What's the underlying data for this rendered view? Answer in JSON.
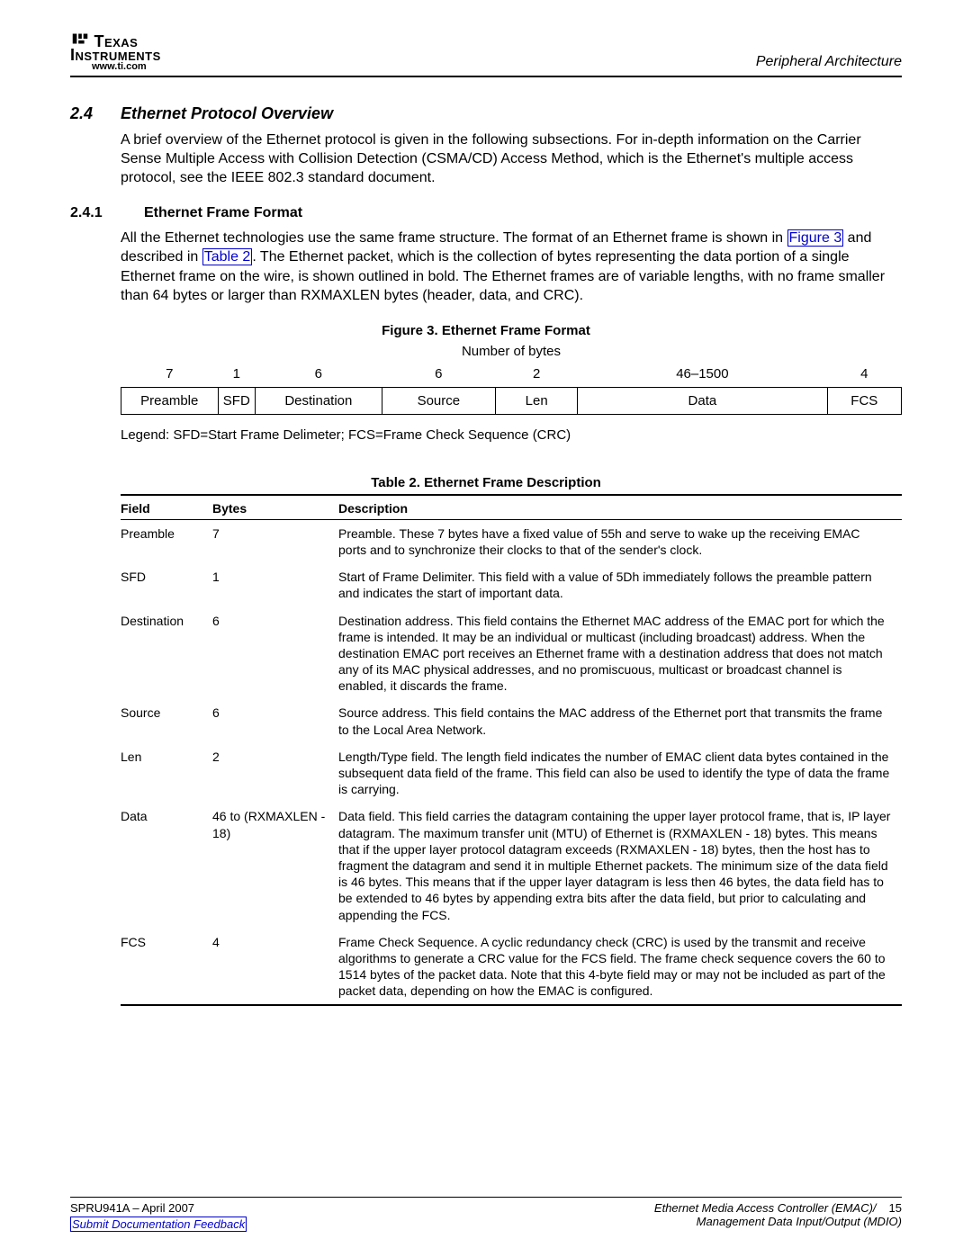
{
  "header": {
    "brand2": "Texas",
    "brand3": "Instruments",
    "url": "www.ti.com",
    "section_label": "Peripheral Architecture"
  },
  "section": {
    "num": "2.4",
    "title": "Ethernet Protocol Overview",
    "intro": "A brief overview of the Ethernet protocol is given in the following subsections. For in-depth information on the Carrier Sense Multiple Access with Collision Detection (CSMA/CD) Access Method, which is the Ethernet's multiple access protocol, see the IEEE 802.3 standard document."
  },
  "subsection": {
    "num": "2.4.1",
    "title": "Ethernet Frame Format",
    "p_pre": "All the Ethernet technologies use the same frame structure. The format of an Ethernet frame is shown in ",
    "link1": "Figure 3",
    "p_mid": " and described in ",
    "link2": "Table 2",
    "p_post": ". The Ethernet packet, which is the collection of bytes representing the data portion of a single Ethernet frame on the wire, is shown outlined in bold. The Ethernet frames are of variable lengths, with no frame smaller than 64 bytes or larger than RXMAXLEN bytes (header, data, and CRC)."
  },
  "figure": {
    "title": "Figure 3. Ethernet Frame Format",
    "num_bytes_label": "Number of bytes",
    "bytes": [
      "7",
      "1",
      "6",
      "6",
      "2",
      "46–1500",
      "4"
    ],
    "cells": [
      "Preamble",
      "SFD",
      "Destination",
      "Source",
      "Len",
      "Data",
      "FCS"
    ],
    "legend": "Legend: SFD=Start Frame Delimeter; FCS=Frame Check Sequence (CRC)"
  },
  "table": {
    "title": "Table 2. Ethernet Frame Description",
    "headers": [
      "Field",
      "Bytes",
      "Description"
    ],
    "rows": [
      {
        "field": "Preamble",
        "bytes": "7",
        "desc": "Preamble. These 7 bytes have a fixed value of 55h and serve to wake up the receiving EMAC ports and to synchronize their clocks to that of the sender's clock."
      },
      {
        "field": "SFD",
        "bytes": "1",
        "desc": "Start of Frame Delimiter. This field with a value of 5Dh immediately follows the preamble pattern and indicates the start of important data."
      },
      {
        "field": "Destination",
        "bytes": "6",
        "desc": "Destination address. This field contains the Ethernet MAC address of the EMAC port for which the frame is intended. It may be an individual or multicast (including broadcast) address. When the destination EMAC port receives an Ethernet frame with a destination address that does not match any of its MAC physical addresses, and no promiscuous, multicast or broadcast channel is enabled, it discards the frame."
      },
      {
        "field": "Source",
        "bytes": "6",
        "desc": "Source address. This field contains the MAC address of the Ethernet port that transmits the frame to the Local Area Network."
      },
      {
        "field": "Len",
        "bytes": "2",
        "desc": "Length/Type field. The length field indicates the number of EMAC client data bytes contained in the subsequent data field of the frame. This field can also be used to identify the type of data the frame is carrying."
      },
      {
        "field": "Data",
        "bytes": "46 to (RXMAXLEN - 18)",
        "desc": "Data field. This field carries the datagram containing the upper layer protocol frame, that is, IP layer datagram. The maximum transfer unit (MTU) of Ethernet is (RXMAXLEN - 18) bytes. This means that if the upper layer protocol datagram exceeds (RXMAXLEN - 18) bytes, then the host has to fragment the datagram and send it in multiple Ethernet packets. The minimum size of the data field is 46 bytes. This means that if the upper layer datagram is less then 46 bytes, the data field has to be extended to 46 bytes by appending extra bits after the data field, but prior to calculating and appending the FCS."
      },
      {
        "field": "FCS",
        "bytes": "4",
        "desc": "Frame Check Sequence. A cyclic redundancy check (CRC) is used by the transmit and receive algorithms to generate a CRC value for the FCS field. The frame check sequence covers the 60 to 1514 bytes of the packet data. Note that this 4-byte field may or may not be included as part of the packet data, depending on how the EMAC is configured."
      }
    ]
  },
  "footer": {
    "docid": "SPRU941A – April 2007",
    "feedback": "Submit Documentation Feedback",
    "title1": "Ethernet Media Access Controller (EMAC)/",
    "title2": "Management Data Input/Output (MDIO)",
    "page": "15"
  }
}
